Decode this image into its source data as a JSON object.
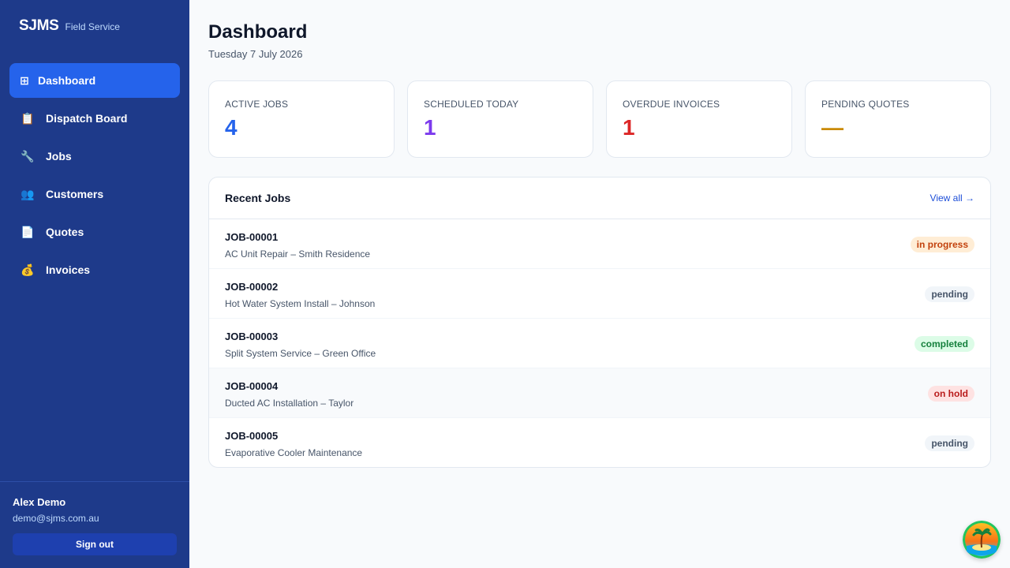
{
  "app": {
    "brand": "SJMS",
    "subtitle": "Field Service"
  },
  "sidebar": {
    "items": [
      {
        "label": "Dashboard",
        "icon": "grid-icon",
        "glyph": "⊞",
        "active": true
      },
      {
        "label": "Dispatch Board",
        "icon": "clipboard-icon",
        "glyph": "📋",
        "active": false
      },
      {
        "label": "Jobs",
        "icon": "wrench-icon",
        "glyph": "🔧",
        "active": false
      },
      {
        "label": "Customers",
        "icon": "people-icon",
        "glyph": "👥",
        "active": false
      },
      {
        "label": "Quotes",
        "icon": "document-icon",
        "glyph": "📄",
        "active": false
      },
      {
        "label": "Invoices",
        "icon": "money-bag-icon",
        "glyph": "💰",
        "active": false
      }
    ],
    "user": {
      "name": "Alex Demo",
      "email": "demo@sjms.com.au",
      "signout_label": "Sign out"
    }
  },
  "header": {
    "title": "Dashboard",
    "date": "Tuesday 7 July 2026"
  },
  "stats": [
    {
      "label": "ACTIVE JOBS",
      "value": "4",
      "color": "#2563eb"
    },
    {
      "label": "SCHEDULED TODAY",
      "value": "1",
      "color": "#7c3aed"
    },
    {
      "label": "OVERDUE INVOICES",
      "value": "1",
      "color": "#dc2626"
    },
    {
      "label": "PENDING QUOTES",
      "value": "—",
      "color": "#ca8a04"
    }
  ],
  "recent_jobs": {
    "title": "Recent Jobs",
    "view_all_label": "View all →",
    "rows": [
      {
        "id": "JOB-00001",
        "desc": "AC Unit Repair – Smith Residence",
        "status": "in progress",
        "badge_bg": "#ffedd5",
        "badge_fg": "#c2410c"
      },
      {
        "id": "JOB-00002",
        "desc": "Hot Water System Install – Johnson",
        "status": "pending",
        "badge_bg": "#f1f5f9",
        "badge_fg": "#475569"
      },
      {
        "id": "JOB-00003",
        "desc": "Split System Service – Green Office",
        "status": "completed",
        "badge_bg": "#dcfce7",
        "badge_fg": "#15803d"
      },
      {
        "id": "JOB-00004",
        "desc": "Ducted AC Installation – Taylor",
        "status": "on hold",
        "badge_bg": "#fee2e2",
        "badge_fg": "#b91c1c"
      },
      {
        "id": "JOB-00005",
        "desc": "Evaporative Cooler Maintenance",
        "status": "pending",
        "badge_bg": "#f1f5f9",
        "badge_fg": "#475569"
      }
    ]
  },
  "colors": {
    "sidebar_bg": "#1e3a8a",
    "active_nav": "#2563eb",
    "page_bg": "#f8fafc"
  },
  "assistant": {
    "icon": "island-avatar-icon"
  }
}
